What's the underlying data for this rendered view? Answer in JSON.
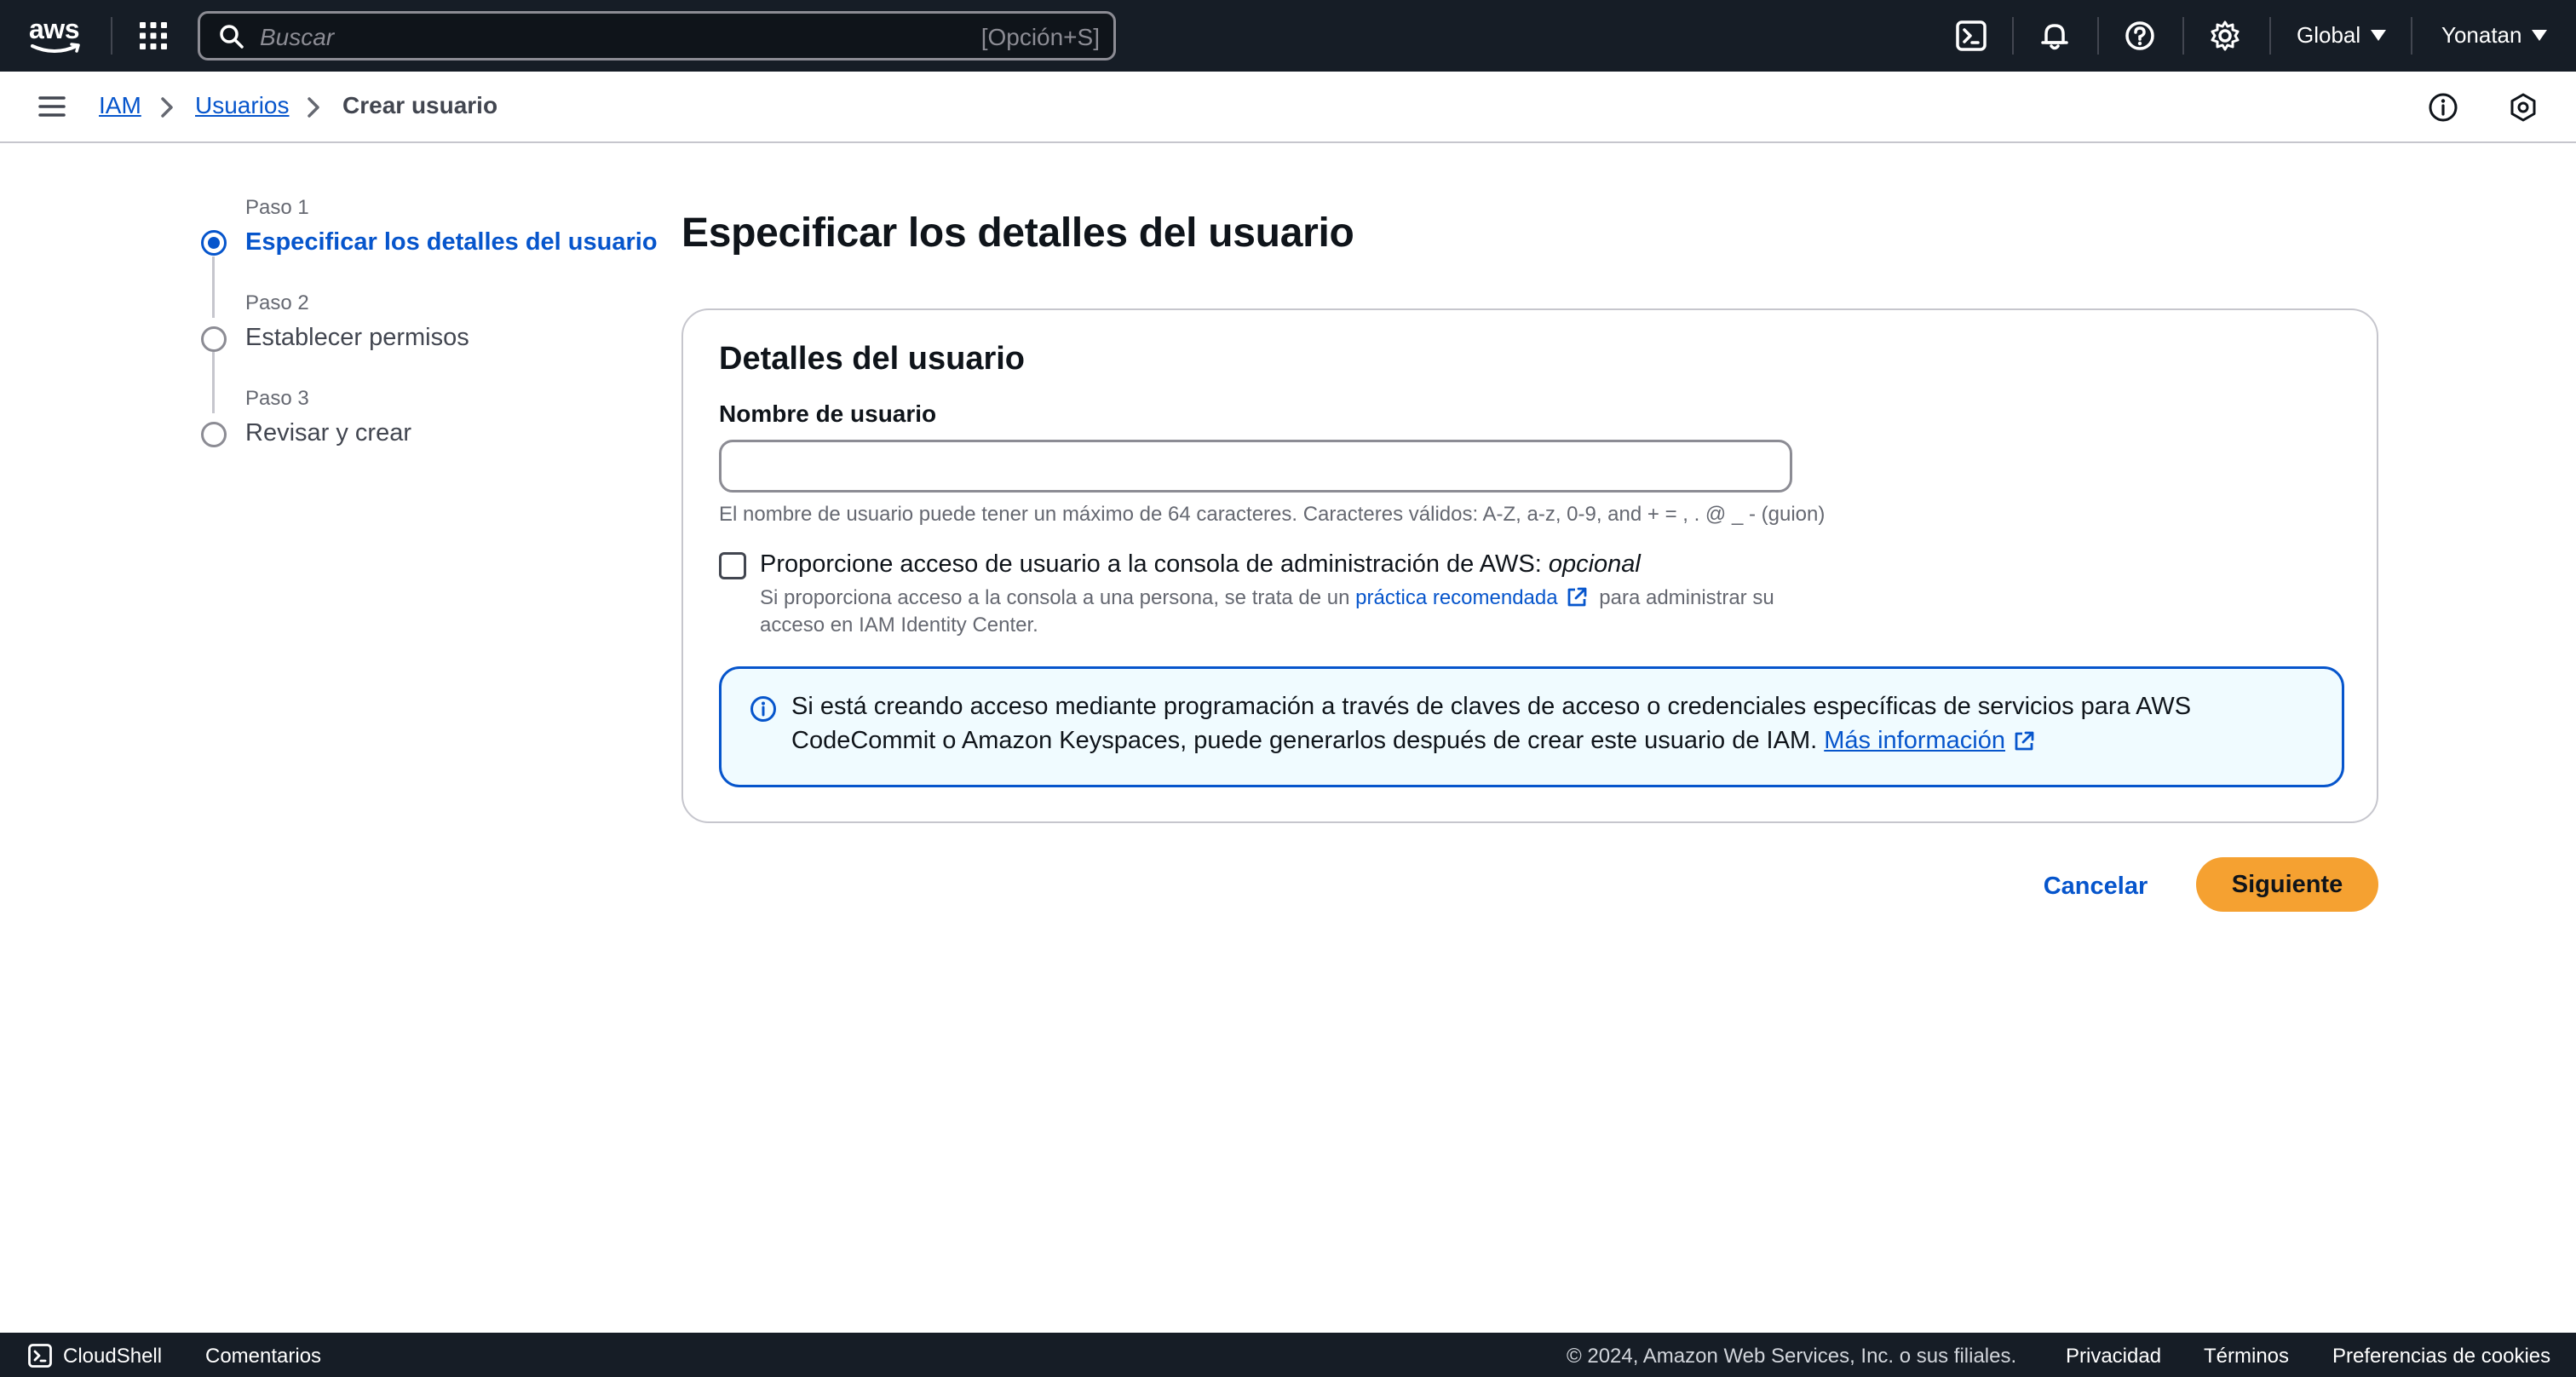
{
  "topnav": {
    "logo_text": "aws",
    "search_placeholder": "Buscar",
    "search_shortcut": "[Opción+S]",
    "region": "Global",
    "user": "Yonatan",
    "icons": [
      "cloudshell-icon",
      "bell-icon",
      "help-icon",
      "gear-icon"
    ]
  },
  "breadcrumb": {
    "items": [
      "IAM",
      "Usuarios",
      "Crear usuario"
    ]
  },
  "steps": [
    {
      "num": "Paso 1",
      "label": "Especificar los detalles del usuario",
      "active": true
    },
    {
      "num": "Paso 2",
      "label": "Establecer permisos",
      "active": false
    },
    {
      "num": "Paso 3",
      "label": "Revisar y crear",
      "active": false
    }
  ],
  "main": {
    "title": "Especificar los detalles del usuario",
    "panel_title": "Detalles del usuario",
    "username_label": "Nombre de usuario",
    "username_value": "",
    "username_hint": "El nombre de usuario puede tener un máximo de 64 caracteres. Caracteres válidos: A-Z, a-z, 0-9, and + = , . @ _ - (guion)",
    "console_access_label": "Proporcione acceso de usuario a la consola de administración de AWS:",
    "console_access_optional": "opcional",
    "console_access_checked": false,
    "console_desc_before": "Si proporciona acceso a la consola a una persona, se trata de un",
    "console_desc_link": "práctica recomendada",
    "console_desc_after": "para administrar su acceso en IAM Identity Center.",
    "alert_text": "Si está creando acceso mediante programación a través de claves de acceso o credenciales específicas de servicios para AWS CodeCommit o Amazon Keyspaces, puede generarlos después de crear este usuario de IAM.",
    "alert_link": "Más información"
  },
  "actions": {
    "cancel": "Cancelar",
    "next": "Siguiente"
  },
  "footer": {
    "cloudshell": "CloudShell",
    "feedback": "Comentarios",
    "copyright": "© 2024, Amazon Web Services, Inc. o sus filiales.",
    "privacy": "Privacidad",
    "terms": "Términos",
    "cookies": "Preferencias de cookies"
  },
  "colors": {
    "nav_bg": "#161d26",
    "link": "#0655cc",
    "primary_button": "#f5a131",
    "alert_bg": "#f0fbff"
  }
}
